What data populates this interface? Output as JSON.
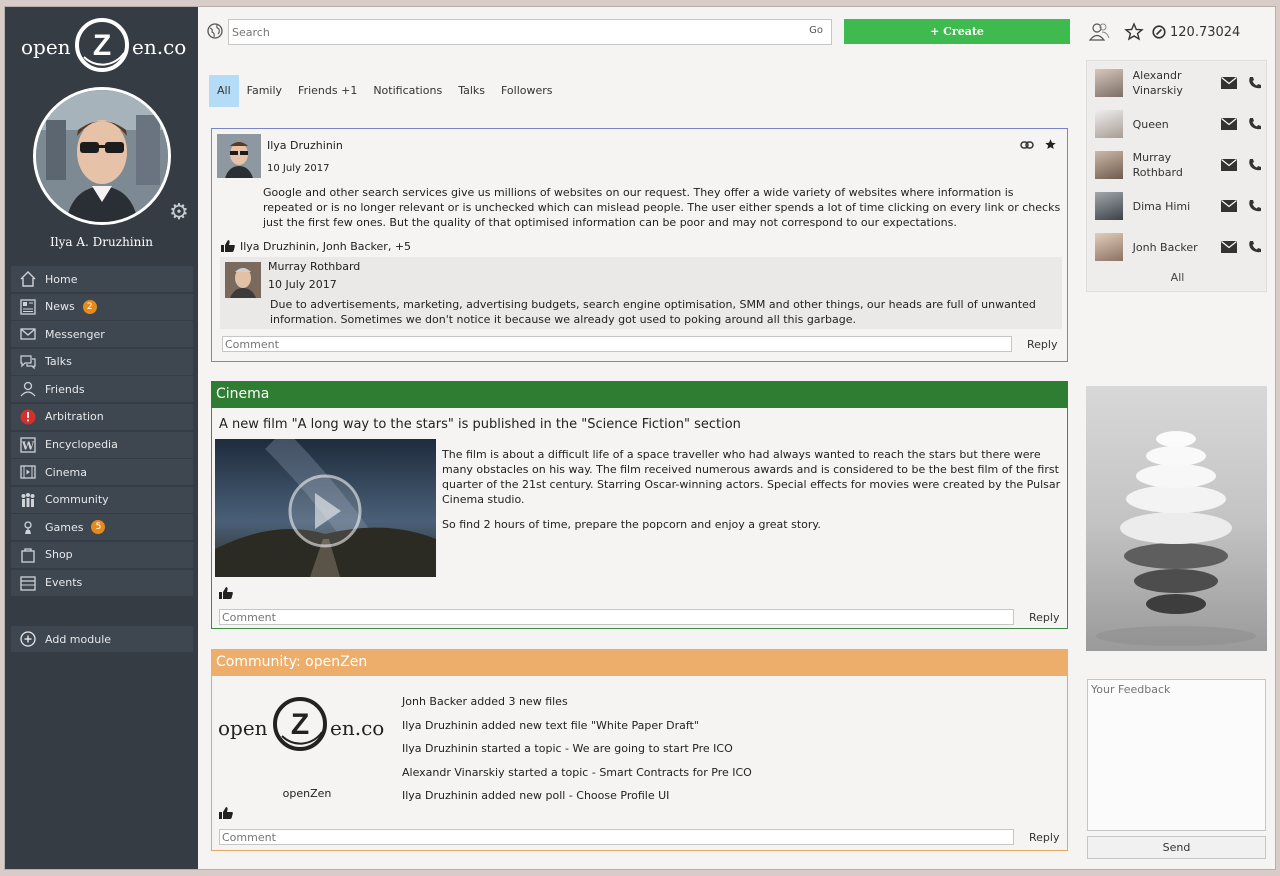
{
  "app": {
    "logo_left": "open",
    "logo_letter": "Z",
    "logo_right": "en.co"
  },
  "user": {
    "name": "Ilya A. Druzhinin"
  },
  "sidebar": {
    "items": [
      {
        "label": "Home",
        "icon": "home-icon"
      },
      {
        "label": "News",
        "icon": "news-icon",
        "badge": "2"
      },
      {
        "label": "Messenger",
        "icon": "messenger-icon"
      },
      {
        "label": "Talks",
        "icon": "talks-icon"
      },
      {
        "label": "Friends",
        "icon": "friends-icon"
      },
      {
        "label": "Arbitration",
        "icon": "arbitration-icon"
      },
      {
        "label": "Encyclopedia",
        "icon": "encyclopedia-icon"
      },
      {
        "label": "Cinema",
        "icon": "cinema-icon"
      },
      {
        "label": "Community",
        "icon": "community-icon"
      },
      {
        "label": "Games",
        "icon": "games-icon",
        "badge": "5"
      },
      {
        "label": "Shop",
        "icon": "shop-icon"
      },
      {
        "label": "Events",
        "icon": "events-icon"
      }
    ],
    "add_module": "Add module"
  },
  "topbar": {
    "search_placeholder": "Search",
    "go": "Go",
    "create": "+ Create",
    "balance": "120.73024"
  },
  "tabs": [
    "All",
    "Family",
    "Friends +1",
    "Notifications",
    "Talks",
    "Followers"
  ],
  "post1": {
    "author": "Ilya Druzhinin",
    "date": "10 July 2017",
    "text": "Google and other search services give us millions of websites on our request. They offer a wide variety of websites where information is repeated or is no longer relevant or is unchecked which can mislead people.  The user either spends a lot of time clicking on every link or checks just the first few ones. But the quality of that optimised information can be poor and may not correspond to our expectations.",
    "likes": "Ilya Druzhinin, Jonh Backer, +5",
    "reply": {
      "author": "Murray Rothbard",
      "date": "10 July 2017",
      "text": "Due to advertisements, marketing, advertising budgets, search engine optimisation, SMM and other things, our heads are full of unwanted information. Sometimes we don't notice it because we already got used to poking around all this garbage."
    },
    "comment_placeholder": "Comment",
    "reply_label": "Reply"
  },
  "cinema": {
    "header": "Cinema",
    "title": "A new film \"A long way to the stars\" is published in the \"Science Fiction\" section",
    "desc1": "The film is about a difficult life of a space traveller who had always wanted to reach the stars but there were many obstacles on his way. The film received numerous awards and is considered to be the best film of the first quarter of the 21st century. Starring Oscar-winning actors. Special effects for movies were created by the Pulsar Cinema studio.",
    "desc2": "So find 2 hours of time, prepare the popcorn and enjoy a great story.",
    "comment_placeholder": "Comment",
    "reply_label": "Reply"
  },
  "community": {
    "header": "Community: openZen",
    "caption": "openZen",
    "events": [
      "Jonh Backer added 3 new files",
      "Ilya Druzhinin added new text file \"White Paper Draft\"",
      "Ilya Druzhinin started a topic - We are going to start Pre ICO",
      "Alexandr Vinarskiy started a topic - Smart Contracts for Pre ICO",
      "Ilya Druzhinin added new poll - Choose Profile UI"
    ],
    "comment_placeholder": "Comment",
    "reply_label": "Reply"
  },
  "contacts": {
    "items": [
      {
        "name": "Alexandr Vinarskiy"
      },
      {
        "name": "Queen"
      },
      {
        "name": "Murray Rothbard"
      },
      {
        "name": "Dima Himi"
      },
      {
        "name": "Jonh Backer"
      }
    ],
    "all": "All"
  },
  "feedback": {
    "placeholder": "Your Feedback",
    "send": "Send"
  },
  "colors": {
    "create_green": "#3fba4f",
    "cinema_green": "#2e7d32",
    "community_orange": "#ecae6a",
    "sidebar_bg": "#353c44",
    "active_tab": "#b4dcf6",
    "badge_orange": "#e88a1a"
  }
}
